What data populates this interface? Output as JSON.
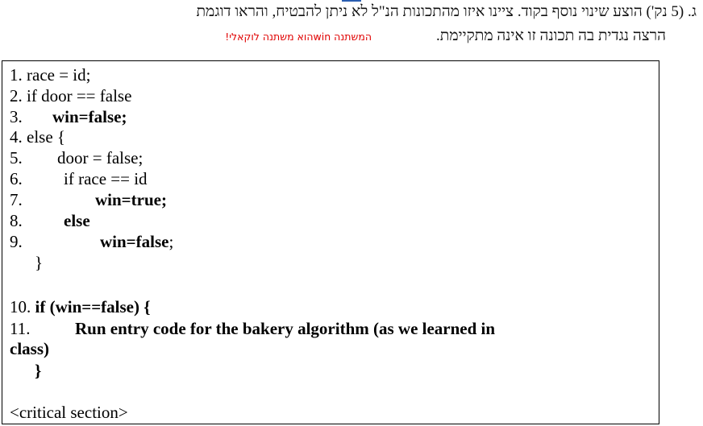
{
  "question": {
    "line1": "ג.   (5 נק') הוצע שינוי נוסף בקוד. ציינו איזו מהתכונות הנ\"ל לא ניתן להבטיח, והראו דוגמת",
    "line2": "הרצה נגדית בה תכונה זו אינה מתקיימת.",
    "note": "המשתנה  winהוא משתנה לוקאלי!"
  },
  "code": {
    "l1": "1. race = id;",
    "l2": "2. if door == false",
    "l3_num": "3.",
    "l3_text": "win=false;",
    "l4": "4. else {",
    "l5_num": "5.",
    "l5_text": "door = false;",
    "l6_num": "6.",
    "l6_text": "if race == id",
    "l7_num": "7.",
    "l7_text": "win=true;",
    "l8_num": "8.",
    "l8_text": "else",
    "l9_num": "9.",
    "l9_text": "win=false",
    "l9_semi": ";",
    "close1": "}",
    "l10_num": "10.",
    "l10_text": "if (win==false) {",
    "l11_num": "11.",
    "l11_text": "Run entry code for the bakery algorithm (as we learned in",
    "l11_cont": "class)",
    "close2": "}",
    "critical": "<critical section>"
  }
}
